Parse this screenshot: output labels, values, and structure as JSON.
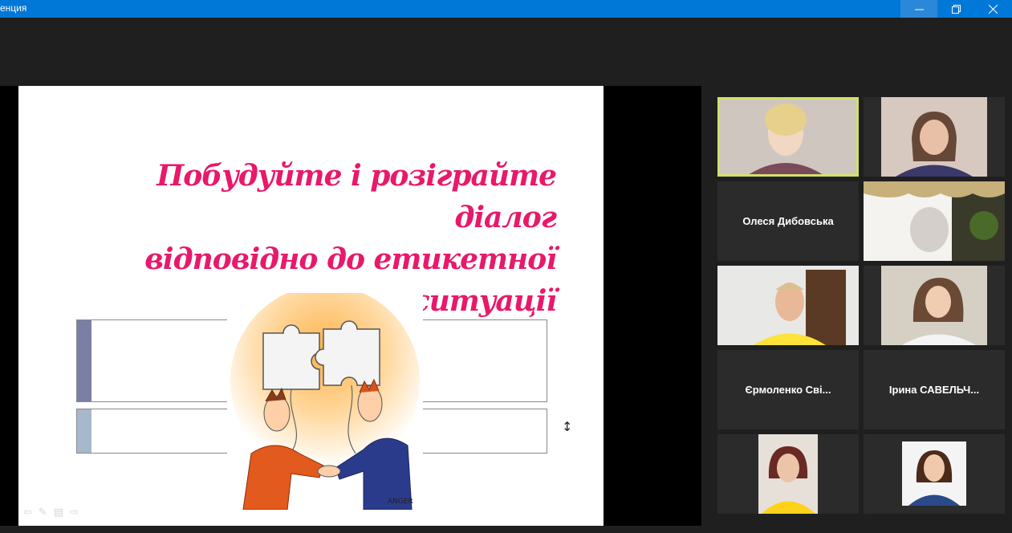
{
  "window": {
    "title": "енция",
    "min_icon": "minimize-icon",
    "max_icon": "restore-icon",
    "close_icon": "close-icon"
  },
  "slide": {
    "title_lines": [
      "Побудуйте і розіграйте діалог",
      "відповідно до етикетної",
      "ситуації"
    ],
    "cartoon_signature": "ANGER",
    "nav_icons": [
      "prev-icon",
      "pen-icon",
      "slides-icon",
      "next-icon"
    ]
  },
  "participants": [
    {
      "name": "",
      "video": true
    },
    {
      "name": "",
      "video": true
    },
    {
      "name": "Олеся Дибовська",
      "video": false
    },
    {
      "name": "",
      "video": true
    },
    {
      "name": "",
      "video": true
    },
    {
      "name": "",
      "video": true
    },
    {
      "name": "Єрмоленко  Сві...",
      "video": false
    },
    {
      "name": "Ірина  САВЕЛЬЧ...",
      "video": false
    },
    {
      "name": "",
      "video": true
    },
    {
      "name": "",
      "video": true
    }
  ],
  "colors": {
    "titlebar": "#0078d7",
    "slide_title": "#e8196b",
    "active_speaker": "#d3e06a"
  }
}
